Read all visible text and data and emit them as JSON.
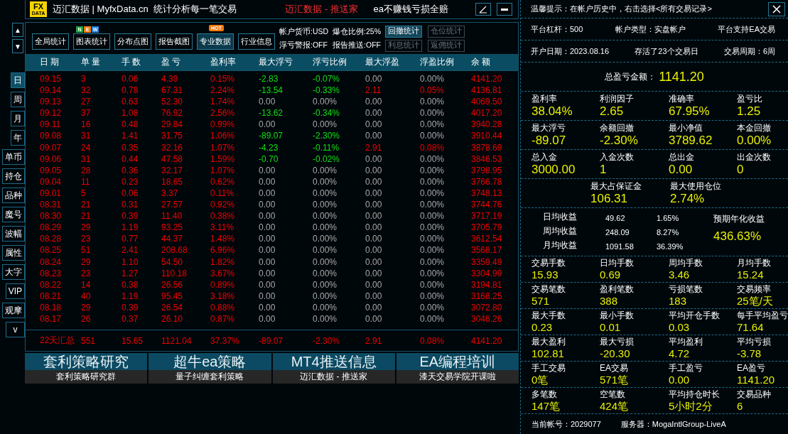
{
  "title_bar": {
    "logo": {
      "top": "FX",
      "bottom": "DATA"
    },
    "title": "迈汇数据 | MyfxData.cn  统计分析每一笔交易",
    "slogan": "迈汇数据 - 推送家",
    "promise": "ea不赚钱亏损全赔"
  },
  "nav_arrows": [
    "▲",
    "▼"
  ],
  "side_tabs": [
    {
      "label": "日",
      "selected": true
    },
    {
      "label": "周",
      "selected": false
    },
    {
      "label": "月",
      "selected": false
    },
    {
      "label": "年",
      "selected": false
    },
    {
      "label": "单币",
      "selected": false
    },
    {
      "label": "持仓",
      "selected": false
    },
    {
      "label": "品种",
      "selected": false
    },
    {
      "label": "魔号",
      "selected": false
    },
    {
      "label": "波幅",
      "selected": false
    },
    {
      "label": "属性",
      "selected": false
    },
    {
      "label": "大字",
      "selected": false
    },
    {
      "label": "VIP",
      "selected": false
    },
    {
      "label": "观摩",
      "selected": false
    },
    {
      "label": "v",
      "selected": false
    }
  ],
  "toolbar": [
    {
      "label": "全局统计",
      "selected": false
    },
    {
      "label": "图表统计",
      "selected": false,
      "badge": {
        "kind": "new",
        "letters": [
          {
            "text": "N",
            "color": "#1f9e3a"
          },
          {
            "text": "E",
            "color": "#f07a10"
          },
          {
            "text": "W",
            "color": "#1e7fe0"
          }
        ]
      }
    },
    {
      "label": "分布点图",
      "selected": false
    },
    {
      "label": "报告截图",
      "selected": false
    },
    {
      "label": "专业数据",
      "selected": true,
      "badge": {
        "kind": "hot",
        "text": "HOT"
      }
    },
    {
      "label": "行业信息",
      "selected": false
    }
  ],
  "account_flags": [
    [
      "帐户货币:USD",
      "浮亏警报:OFF"
    ],
    [
      "爆仓比例:25%",
      "报告推送:OFF"
    ]
  ],
  "stat_buttons": [
    {
      "label": "回撤统计",
      "selected": true
    },
    {
      "label": "仓位统计",
      "selected": false
    },
    {
      "label": "利息统计",
      "selected": false
    },
    {
      "label": "返佣统计",
      "selected": false
    }
  ],
  "table": {
    "columns": [
      "日 期",
      "单 量",
      "手 数",
      "盈 亏",
      "盈利率",
      "最大浮亏",
      "浮亏比例",
      "最大浮盈",
      "浮盈比例",
      "余 额"
    ],
    "rows": [
      {
        "cells": [
          "09.15",
          "3",
          "0.06",
          "4.39",
          "0.15%",
          "-2.83",
          "-0.07%",
          "0.00",
          "0.00%",
          "4141.20"
        ],
        "float_loss_active": true,
        "float_profit_active": false
      },
      {
        "cells": [
          "09.14",
          "32",
          "0.78",
          "67.31",
          "2.24%",
          "-13.54",
          "-0.33%",
          "2.11",
          "0.05%",
          "4136.81"
        ],
        "float_loss_active": true,
        "float_profit_active": true
      },
      {
        "cells": [
          "09.13",
          "27",
          "0.63",
          "52.30",
          "1.74%",
          "0.00",
          "0.00%",
          "0.00",
          "0.00%",
          "4069.50"
        ],
        "float_loss_active": false,
        "float_profit_active": false
      },
      {
        "cells": [
          "09.12",
          "37",
          "1.08",
          "76.92",
          "2.56%",
          "-13.62",
          "-0.34%",
          "0.00",
          "0.00%",
          "4017.20"
        ],
        "float_loss_active": true,
        "float_profit_active": false
      },
      {
        "cells": [
          "09.11",
          "16",
          "0.48",
          "29.84",
          "0.99%",
          "0.00",
          "0.00%",
          "0.00",
          "0.00%",
          "3940.28"
        ],
        "float_loss_active": false,
        "float_profit_active": false
      },
      {
        "cells": [
          "09.08",
          "31",
          "1.41",
          "31.75",
          "1.06%",
          "-89.07",
          "-2.30%",
          "0.00",
          "0.00%",
          "3910.44"
        ],
        "float_loss_active": true,
        "float_profit_active": false
      },
      {
        "cells": [
          "09.07",
          "24",
          "0.35",
          "32.16",
          "1.07%",
          "-4.23",
          "-0.11%",
          "2.91",
          "0.08%",
          "3878.69"
        ],
        "float_loss_active": true,
        "float_profit_active": true
      },
      {
        "cells": [
          "09.06",
          "31",
          "0.44",
          "47.58",
          "1.59%",
          "-0.70",
          "-0.02%",
          "0.00",
          "0.00%",
          "3846.53"
        ],
        "float_loss_active": true,
        "float_profit_active": false
      },
      {
        "cells": [
          "09.05",
          "28",
          "0.36",
          "32.17",
          "1.07%",
          "0.00",
          "0.00%",
          "0.00",
          "0.00%",
          "3798.95"
        ],
        "float_loss_active": false,
        "float_profit_active": false
      },
      {
        "cells": [
          "09.04",
          "11",
          "0.23",
          "18.65",
          "0.62%",
          "0.00",
          "0.00%",
          "0.00",
          "0.00%",
          "3766.78"
        ],
        "float_loss_active": false,
        "float_profit_active": false
      },
      {
        "cells": [
          "09.01",
          "5",
          "0.06",
          "3.37",
          "0.11%",
          "0.00",
          "0.00%",
          "0.00",
          "0.00%",
          "3748.13"
        ],
        "float_loss_active": false,
        "float_profit_active": false
      },
      {
        "cells": [
          "08.31",
          "21",
          "0.31",
          "27.57",
          "0.92%",
          "0.00",
          "0.00%",
          "0.00",
          "0.00%",
          "3744.76"
        ],
        "float_loss_active": false,
        "float_profit_active": false
      },
      {
        "cells": [
          "08.30",
          "21",
          "0.39",
          "11.40",
          "0.38%",
          "0.00",
          "0.00%",
          "0.00",
          "0.00%",
          "3717.19"
        ],
        "float_loss_active": false,
        "float_profit_active": false
      },
      {
        "cells": [
          "08.29",
          "29",
          "1.19",
          "93.25",
          "3.11%",
          "0.00",
          "0.00%",
          "0.00",
          "0.00%",
          "3705.79"
        ],
        "float_loss_active": false,
        "float_profit_active": false
      },
      {
        "cells": [
          "08.28",
          "23",
          "0.77",
          "44.37",
          "1.48%",
          "0.00",
          "0.00%",
          "0.00",
          "0.00%",
          "3612.54"
        ],
        "float_loss_active": false,
        "float_profit_active": false
      },
      {
        "cells": [
          "08.25",
          "51",
          "2.41",
          "208.68",
          "6.96%",
          "0.00",
          "0.00%",
          "0.00",
          "0.00%",
          "3568.17"
        ],
        "float_loss_active": false,
        "float_profit_active": false
      },
      {
        "cells": [
          "08.24",
          "29",
          "1.10",
          "54.50",
          "1.82%",
          "0.00",
          "0.00%",
          "0.00",
          "0.00%",
          "3359.49"
        ],
        "float_loss_active": false,
        "float_profit_active": false
      },
      {
        "cells": [
          "08.23",
          "23",
          "1.27",
          "110.18",
          "3.67%",
          "0.00",
          "0.00%",
          "0.00",
          "0.00%",
          "3304.99"
        ],
        "float_loss_active": false,
        "float_profit_active": false
      },
      {
        "cells": [
          "08.22",
          "14",
          "0.38",
          "26.56",
          "0.89%",
          "0.00",
          "0.00%",
          "0.00",
          "0.00%",
          "3194.81"
        ],
        "float_loss_active": false,
        "float_profit_active": false
      },
      {
        "cells": [
          "08.21",
          "40",
          "1.19",
          "95.45",
          "3.18%",
          "0.00",
          "0.00%",
          "0.00",
          "0.00%",
          "3168.25"
        ],
        "float_loss_active": false,
        "float_profit_active": false
      },
      {
        "cells": [
          "08.18",
          "29",
          "0.39",
          "26.54",
          "0.88%",
          "0.00",
          "0.00%",
          "0.00",
          "0.00%",
          "3072.80"
        ],
        "float_loss_active": false,
        "float_profit_active": false
      },
      {
        "cells": [
          "08.17",
          "26",
          "0.37",
          "26.10",
          "0.87%",
          "0.00",
          "0.00%",
          "0.00",
          "0.00%",
          "3046.26"
        ],
        "float_loss_active": false,
        "float_profit_active": false
      }
    ],
    "summary": [
      "22天汇总",
      "551",
      "15.65",
      "1121.04",
      "37.37%",
      "-89.07",
      "-2.30%",
      "2.91",
      "0.08%",
      "4141.20"
    ]
  },
  "banners": [
    {
      "title": "套利策略研究",
      "subtitle": "套利策略研究群"
    },
    {
      "title": "超牛ea策略",
      "subtitle": "量子纠缠套利策略"
    },
    {
      "title": "MT4推送信息",
      "subtitle": "迈汇数据 - 推送家"
    },
    {
      "title": "EA编程培训",
      "subtitle": "漆天交易学院开课啦"
    }
  ],
  "tip": "温馨提示：在帐户历史中，右击选择<所有交易记录>",
  "account_info": [
    [
      "平台杠杆：500",
      "帐户类型：实盘帐户",
      "平台支持EA交易"
    ],
    [
      "开户日期：2023.08.16",
      "存活了23个交易日",
      "交易周期：6周"
    ]
  ],
  "total": {
    "label": "总盈亏金额：",
    "value": "1141.20"
  },
  "stats_upper": [
    [
      {
        "label": "盈利率",
        "value": "38.04%"
      },
      {
        "label": "利润因子",
        "value": "2.65"
      },
      {
        "label": "准确率",
        "value": "67.95%"
      },
      {
        "label": "盈亏比",
        "value": "1.25"
      }
    ],
    [
      {
        "label": "最大浮亏",
        "value": "-89.07"
      },
      {
        "label": "余额回撤",
        "value": "-2.30%"
      },
      {
        "label": "最小净值",
        "value": "3789.62"
      },
      {
        "label": "本金回撤",
        "value": "0.00%"
      }
    ],
    [
      {
        "label": "总入金",
        "value": "3000.00"
      },
      {
        "label": "入金次数",
        "value": "1"
      },
      {
        "label": "总出金",
        "value": "0.00"
      },
      {
        "label": "出金次数",
        "value": "0"
      }
    ],
    [
      {
        "label": "最大占保证金",
        "value": "106.31"
      },
      {
        "label": "最大使用仓位",
        "value": "2.74%"
      }
    ]
  ],
  "averages": {
    "rows": [
      {
        "label": "日均收益",
        "amount": "49.62",
        "percent": "1.65%"
      },
      {
        "label": "周均收益",
        "amount": "248.09",
        "percent": "8.27%"
      },
      {
        "label": "月均收益",
        "amount": "1091.58",
        "percent": "36.39%"
      }
    ],
    "projected": {
      "label": "预期年化收益",
      "value": "436.63%"
    }
  },
  "stats_lower": [
    [
      {
        "label": "交易手数",
        "value": "15.93"
      },
      {
        "label": "日均手数",
        "value": "0.69"
      },
      {
        "label": "周均手数",
        "value": "3.46"
      },
      {
        "label": "月均手数",
        "value": "15.24"
      }
    ],
    [
      {
        "label": "交易笔数",
        "value": "571"
      },
      {
        "label": "盈利笔数",
        "value": "388"
      },
      {
        "label": "亏损笔数",
        "value": "183"
      },
      {
        "label": "交易频率",
        "value": "25笔/天"
      }
    ],
    [
      {
        "label": "最大手数",
        "value": "0.23"
      },
      {
        "label": "最小手数",
        "value": "0.01"
      },
      {
        "label": "平均开仓手数",
        "value": "0.03"
      },
      {
        "label": "每手平均盈亏",
        "value": "71.64"
      }
    ],
    [
      {
        "label": "最大盈利",
        "value": "102.81"
      },
      {
        "label": "最大亏损",
        "value": "-20.30"
      },
      {
        "label": "平均盈利",
        "value": "4.72"
      },
      {
        "label": "平均亏损",
        "value": "-3.78"
      }
    ],
    [
      {
        "label": "手工交易",
        "value": "0笔"
      },
      {
        "label": "EA交易",
        "value": "571笔"
      },
      {
        "label": "手工盈亏",
        "value": "0.00"
      },
      {
        "label": "EA盈亏",
        "value": "1141.20"
      }
    ],
    [
      {
        "label": "多笔数",
        "value": "147笔"
      },
      {
        "label": "空笔数",
        "value": "424笔"
      },
      {
        "label": "平均持仓时长",
        "value": "5小时2分"
      },
      {
        "label": "交易品种",
        "value": "6"
      }
    ]
  ],
  "footer": {
    "account": "当前帐号：2029077",
    "server": "服务器：MogaIntlGroup-LiveA"
  }
}
